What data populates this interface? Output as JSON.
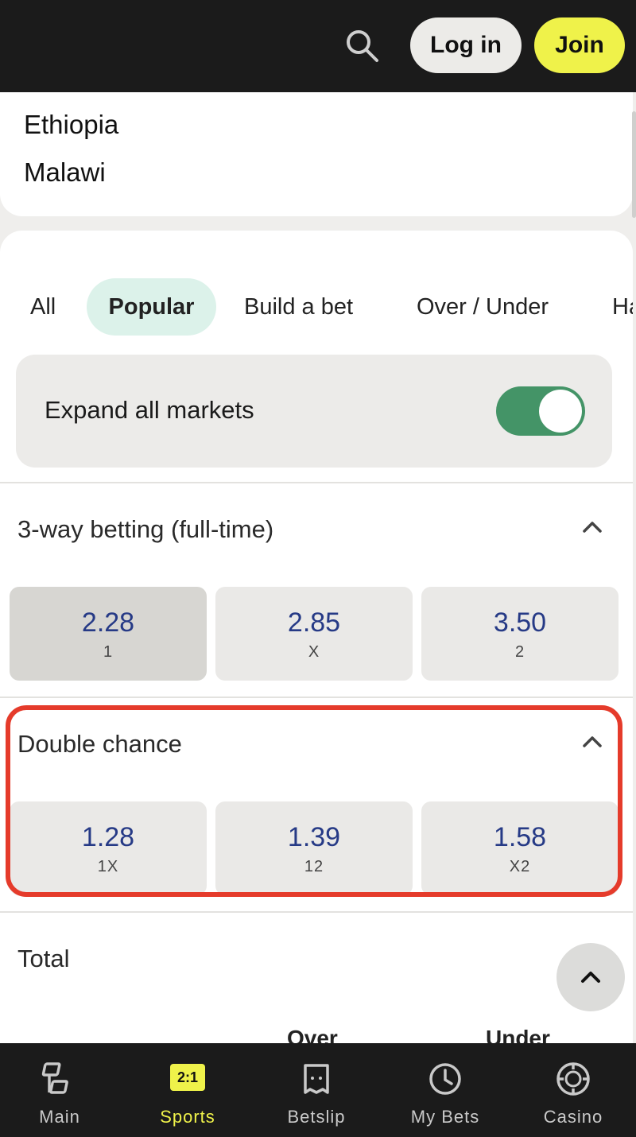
{
  "header": {
    "login_label": "Log in",
    "join_label": "Join"
  },
  "teams": {
    "home": "Ethiopia",
    "away": "Malawi"
  },
  "tabs": [
    {
      "label": "All"
    },
    {
      "label": "Popular"
    },
    {
      "label": "Build a bet"
    },
    {
      "label": "Over / Under"
    },
    {
      "label": "Ha"
    }
  ],
  "expand": {
    "label": "Expand all markets",
    "enabled": true
  },
  "markets": [
    {
      "title": "3-way betting (full-time)",
      "odds": [
        {
          "value": "2.28",
          "label": "1",
          "selected": true
        },
        {
          "value": "2.85",
          "label": "X"
        },
        {
          "value": "3.50",
          "label": "2"
        }
      ]
    },
    {
      "title": "Double chance",
      "odds": [
        {
          "value": "1.28",
          "label": "1X"
        },
        {
          "value": "1.39",
          "label": "12"
        },
        {
          "value": "1.58",
          "label": "X2"
        }
      ]
    },
    {
      "title": "Total",
      "columns": [
        "Over",
        "Under"
      ]
    }
  ],
  "bottom_nav": [
    {
      "label": "Main"
    },
    {
      "label": "Sports",
      "badge": "2:1",
      "active": true
    },
    {
      "label": "Betslip"
    },
    {
      "label": "My Bets"
    },
    {
      "label": "Casino"
    }
  ],
  "colors": {
    "accent": "#eff24a",
    "toggle": "#449467",
    "odds_text": "#263a86",
    "highlight": "#e53b2b"
  }
}
